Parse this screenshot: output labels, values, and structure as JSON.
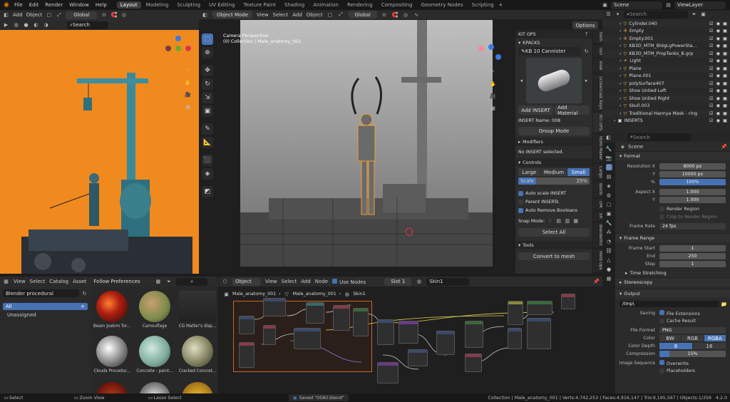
{
  "menu": {
    "items": [
      "File",
      "Edit",
      "Render",
      "Window",
      "Help"
    ],
    "workspaces": [
      "Layout",
      "Modeling",
      "Sculpting",
      "UV Editing",
      "Texture Paint",
      "Shading",
      "Animation",
      "Rendering",
      "Compositing",
      "Geometry Nodes",
      "Scripting"
    ],
    "active_workspace": "Layout",
    "scene": "Scene",
    "view_layer": "ViewLayer"
  },
  "left_viewport": {
    "header_items": [
      "Add",
      "Object"
    ],
    "transform": "Global",
    "search_placeholder": "Search"
  },
  "main_viewport": {
    "mode": "Object Mode",
    "header_items": [
      "View",
      "Select",
      "Add",
      "Object"
    ],
    "transform": "Global",
    "options_label": "Options",
    "overlay_text_1": "Camera Perspective",
    "overlay_text_2": "(0) Collection | Male_anatomy_001"
  },
  "kitops": {
    "title": "KIT OPS",
    "kpacks_label": "KPACKS",
    "kpack_name": "KB 10 Cannister",
    "add_insert": "Add INSERT",
    "add_material": "Add Material",
    "insert_name": "INSERT Name: 008",
    "group_mode": "Group Mode",
    "modifiers_label": "Modifiers",
    "no_insert": "No INSERT selected.",
    "controls_label": "Controls",
    "size_options": [
      "Large",
      "Medium",
      "Small"
    ],
    "size_active": "Small",
    "scale_label": "Scale",
    "scale_value": "25%",
    "checks": [
      {
        "label": "Auto scale INSERT",
        "on": true
      },
      {
        "label": "Parent INSERTs",
        "on": false
      },
      {
        "label": "Auto Remove Booleans",
        "on": true
      }
    ],
    "snap_mode_label": "Snap Mode:",
    "select_all": "Select All",
    "tools_label": "Tools",
    "convert_to_mesh": "Convert to mesh"
  },
  "side_tabs": [
    "Item",
    "Tool",
    "View",
    "Screencast Keys",
    "KIT OPS",
    "HDRI Maker",
    "Cargo",
    "Bsorb",
    "DM",
    "SR",
    "BlenderKit",
    "Hard Ops"
  ],
  "outliner": {
    "search_placeholder": "Search",
    "items": [
      "Cylinder.040",
      "Empty",
      "Empty.001",
      "KB3D_MTM_BldgLgPowerStation_",
      "KB3D_MTM_PropTanks_B.grp",
      "Light",
      "Plane",
      "Plane.001",
      "polySurface407",
      "Shoe Untied Left",
      "Shoe Untied Right",
      "Skull.003",
      "Traditional Hannya Mask - ring",
      "INSERTS"
    ]
  },
  "properties": {
    "search_placeholder": "Search",
    "context": "Scene",
    "format_label": "Format",
    "rows": [
      {
        "label": "Resolution X",
        "value": "8000 px"
      },
      {
        "label": "Y",
        "value": "10000 px"
      },
      {
        "label": "%",
        "value": "100%",
        "blue": true
      },
      {
        "label": "Aspect X",
        "value": "1.000"
      },
      {
        "label": "Y",
        "value": "1.000"
      }
    ],
    "render_region": "Render Region",
    "crop_region": "Crop to Render Region",
    "frame_rate_label": "Frame Rate",
    "frame_rate_value": "24 fps",
    "frame_range_label": "Frame Range",
    "frame_rows": [
      {
        "label": "Frame Start",
        "value": "1"
      },
      {
        "label": "End",
        "value": "250"
      },
      {
        "label": "Step",
        "value": "1"
      }
    ],
    "time_stretching": "Time Stretching",
    "stereoscopy": "Stereoscopy",
    "output_label": "Output",
    "output_path": "/tmp\\",
    "saving_label": "Saving",
    "file_extensions": "File Extensions",
    "cache_result": "Cache Result",
    "file_format_label": "File Format",
    "file_format_value": "PNG",
    "color_label": "Color",
    "color_options": [
      "BW",
      "RGB",
      "RGBA"
    ],
    "color_active": "RGBA",
    "color_depth_label": "Color Depth",
    "color_depth_options": [
      "8",
      "16"
    ],
    "color_depth_active": "8",
    "compression_label": "Compression",
    "compression_value": "15%",
    "compression_fraction": 0.15,
    "image_sequence_label": "Image Sequence",
    "overwrite": "Overwrite",
    "placeholders": "Placeholders"
  },
  "asset_browser": {
    "header_items": [
      "View",
      "Select",
      "Catalog",
      "Asset"
    ],
    "preference": "Follow Preferences",
    "library": "Blender procedural",
    "catalog_all": "All",
    "catalog_unassigned": "Unassigned",
    "assets": [
      "Beam Joakim Tor...",
      "Camouflage",
      "CG Matter's disp...",
      "Clouds Procedur...",
      "Concrete - paint...",
      "Cracked Concret..."
    ]
  },
  "node_editor": {
    "object_label": "Object",
    "header_items": [
      "View",
      "Select",
      "Add",
      "Node"
    ],
    "use_nodes": "Use Nodes",
    "slot": "Slot 1",
    "material": "Skin1",
    "breadcrumbs": [
      "Male_anatomy_001",
      "Male_anatomy_001",
      "Skin1"
    ]
  },
  "status_bar": {
    "select": "Select",
    "zoom_view": "Zoom View",
    "lasso_select": "Lasso Select",
    "saved": "Saved \"0580.blend\"",
    "stats": "Collection | Male_anatomy_001 | Verts:4,742,253 | Faces:4,916,147 | Tris:9,195,567 | Objects:1/356",
    "version": "4.2.0"
  },
  "colors": {
    "accent": "#4772b3",
    "orange_bg": "#f08a1e",
    "active_outline": "#f0a030"
  }
}
